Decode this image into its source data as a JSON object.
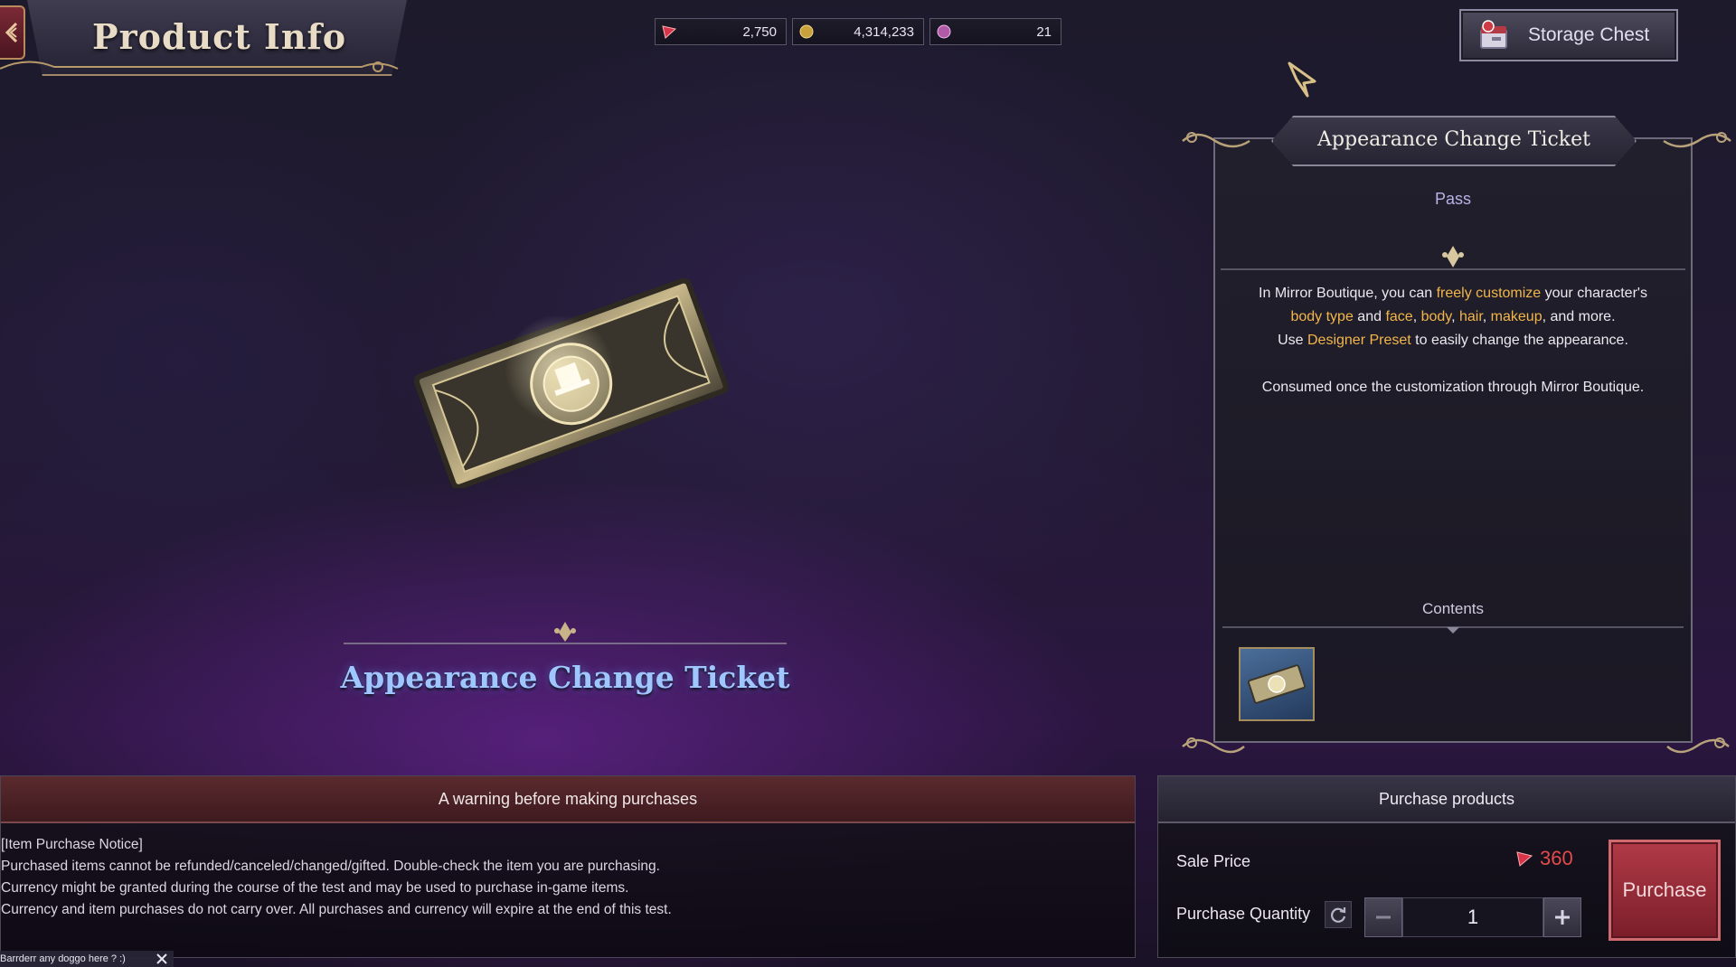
{
  "header": {
    "title": "Product Info",
    "storage_label": "Storage Chest"
  },
  "currencies": [
    {
      "icon": "red-gem-icon",
      "value": "2,750"
    },
    {
      "icon": "gold-coin-icon",
      "value": "4,314,233"
    },
    {
      "icon": "purple-orb-icon",
      "value": "21"
    }
  ],
  "product": {
    "name": "Appearance Change Ticket"
  },
  "info_panel": {
    "title": "Appearance Change Ticket",
    "category": "Pass",
    "desc": {
      "s1": "In Mirror Boutique, you can ",
      "h1": "freely customize",
      "s2": " your character's",
      "h2": "body type",
      "s3": " and ",
      "h3": "face",
      "s4": ", ",
      "h4": "body",
      "s5": ", ",
      "h5": "hair",
      "s6": ", ",
      "h6": "makeup",
      "s7": ", and more.",
      "s8": "Use ",
      "h7": "Designer Preset",
      "s9": " to easily change the appearance.",
      "p2": "Consumed once the customization through Mirror Boutique."
    },
    "contents_label": "Contents"
  },
  "warning": {
    "title": "A warning before making purchases",
    "lines": [
      "[Item Purchase Notice]",
      "Purchased items cannot be refunded/canceled/changed/gifted. Double-check the item you are purchasing.",
      "Currency might be granted during the course of the test and may be used to purchase in-game items.",
      "Currency and item purchases do not carry over.  All purchases and currency will expire at the end of this test."
    ]
  },
  "chat": {
    "text": "Barrderr  any doggo here ? :)"
  },
  "purchase": {
    "title": "Purchase products",
    "sale_label": "Sale Price",
    "price": "360",
    "qty_label": "Purchase Quantity",
    "quantity": "1",
    "button_label": "Purchase"
  },
  "colors": {
    "highlight": "#f2b64a",
    "product_name": "#9fc6ff",
    "price": "#e34a4a",
    "purchase_button": "#9a2c38"
  }
}
